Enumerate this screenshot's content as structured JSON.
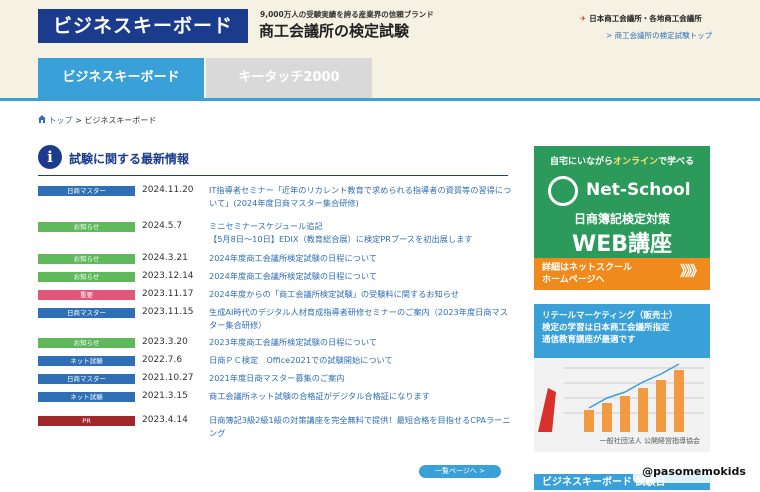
{
  "header": {
    "logo": "ビジネスキーボード",
    "tagline_small": "9,000万人の受験実績を誇る産業界の信頼ブランド",
    "tagline_big": "商工会議所の検定試験",
    "jcci": "日本商工会議所・各地商工会議所",
    "top_link": "> 商工会議所の検定試験トップ"
  },
  "tabs": [
    {
      "label": "ビジネスキーボード",
      "active": true
    },
    {
      "label": "キータッチ2000",
      "active": false
    }
  ],
  "breadcrumb": {
    "home": "トップ",
    "sep": ">",
    "current": "ビジネスキーボード"
  },
  "section": {
    "icon": "i",
    "title": "試験に関する最新情報"
  },
  "news": [
    {
      "badge": "日商マスター",
      "color": "#2f6fb6",
      "date": "2024.11.20",
      "text": "IT指導者セミナー「近年のリカレント教育で求められる指導者の資質等の習得について」(2024年度日商マスター集合研修)"
    },
    {
      "badge": "お知らせ",
      "color": "#5fb85a",
      "date": "2024.5.7",
      "text": "ミニセミナースケジュール追記\n【5月8日〜10日】EDIX（教育総合展）に検定PRブースを初出展します"
    },
    {
      "badge": "お知らせ",
      "color": "#5fb85a",
      "date": "2024.3.21",
      "text": "2024年度商工会議所検定試験の日程について"
    },
    {
      "badge": "お知らせ",
      "color": "#5fb85a",
      "date": "2023.12.14",
      "text": "2024年度商工会議所検定試験の日程について"
    },
    {
      "badge": "重要",
      "color": "#e2567a",
      "date": "2023.11.17",
      "text": "2024年度からの「商工会議所検定試験」の受験料に関するお知らせ"
    },
    {
      "badge": "日商マスター",
      "color": "#2f6fb6",
      "date": "2023.11.15",
      "text": "生成AI時代のデジタル人材育成指導者研修セミナーのご案内（2023年度日商マスター集合研修）"
    },
    {
      "badge": "お知らせ",
      "color": "#5fb85a",
      "date": "2023.3.20",
      "text": "2023年度商工会議所検定試験の日程について"
    },
    {
      "badge": "ネット試験",
      "color": "#2f6fb6",
      "date": "2022.7.6",
      "text": "日商ＰＣ検定　Office2021での試験開始について"
    },
    {
      "badge": "日商マスター",
      "color": "#2f6fb6",
      "date": "2021.10.27",
      "text": "2021年度日商マスター募集のご案内"
    },
    {
      "badge": "ネット試験",
      "color": "#2f6fb6",
      "date": "2021.3.15",
      "text": "商工会議所ネット試験の合格証がデジタル合格証になります"
    },
    {
      "badge": "PR",
      "color": "#a0282b",
      "date": "2023.4.14",
      "text": "日商簿記3級2級1級の対策講座を完全無料で提供！最短合格を目指せるCPAラーニング"
    }
  ],
  "more_button": "一覧ページへ >",
  "ads": {
    "netschool": {
      "top_pre": "自宅にいながら",
      "top_hl": "オンライン",
      "top_post": "で学べる",
      "brand": "Net-School",
      "sub": "日商簿記検定対策",
      "web": "WEB講座",
      "foot1": "詳細はネットスクール",
      "foot2": "ホームページへ",
      "arrows": "》》》"
    },
    "retail": {
      "line1": "リテールマーケティング（販売士）",
      "line2": "検定の学習は日本商工会議所指定",
      "line3": "通信教育講座が最適です",
      "foot": "一般社団法人 公開経営指導協会"
    },
    "bottom": "ビジネスキーボード 試験日"
  },
  "watermark": "@pasomemokids",
  "colors": {
    "navy": "#1b3b8c",
    "accent": "#3aa0d8",
    "link": "#2f6fb6"
  }
}
